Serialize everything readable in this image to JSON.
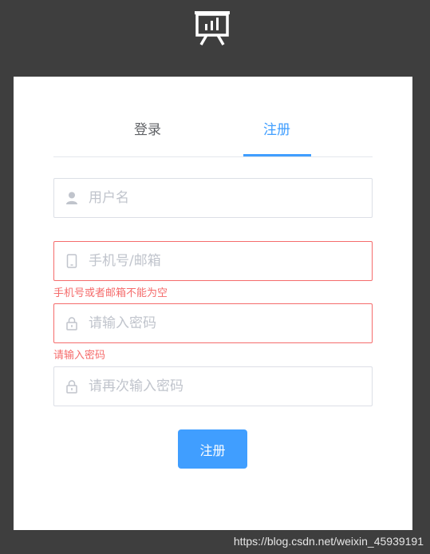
{
  "logo": {
    "icon": "presentation-chart-icon"
  },
  "tabs": {
    "login_label": "登录",
    "register_label": "注册",
    "active": "register"
  },
  "form": {
    "username_placeholder": "用户名",
    "contact_placeholder": "手机号/邮箱",
    "contact_error": "手机号或者邮箱不能为空",
    "password_placeholder": "请输入密码",
    "password_error": "请输入密码",
    "confirm_placeholder": "请再次输入密码",
    "submit_label": "注册"
  },
  "watermark": "https://blog.csdn.net/weixin_45939191",
  "colors": {
    "accent": "#409eff",
    "error": "#f56c6c",
    "background": "#3e3e3e"
  }
}
